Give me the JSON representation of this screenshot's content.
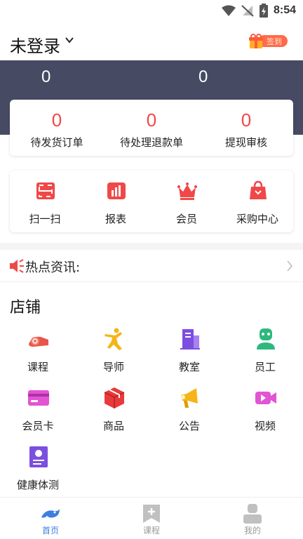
{
  "status_bar": {
    "time": "8:54"
  },
  "header": {
    "title": "未登录",
    "signin_label": "签到"
  },
  "stats": {
    "left_value": "0",
    "right_value": "0"
  },
  "orders": [
    {
      "value": "0",
      "label": "待发货订单"
    },
    {
      "value": "0",
      "label": "待处理退款单"
    },
    {
      "value": "0",
      "label": "提现审核"
    }
  ],
  "tools": [
    {
      "label": "扫一扫",
      "icon": "scan-icon"
    },
    {
      "label": "报表",
      "icon": "report-icon"
    },
    {
      "label": "会员",
      "icon": "crown-icon"
    },
    {
      "label": "采购中心",
      "icon": "shopping-bag-icon"
    }
  ],
  "news": {
    "label": "热点资讯:"
  },
  "store": {
    "title": "店铺",
    "items": [
      {
        "label": "课程",
        "icon": "course-icon"
      },
      {
        "label": "导师",
        "icon": "tutor-icon"
      },
      {
        "label": "教室",
        "icon": "classroom-icon"
      },
      {
        "label": "员工",
        "icon": "staff-icon"
      },
      {
        "label": "会员卡",
        "icon": "member-card-icon"
      },
      {
        "label": "商品",
        "icon": "product-icon"
      },
      {
        "label": "公告",
        "icon": "announcement-icon"
      },
      {
        "label": "视频",
        "icon": "video-icon"
      },
      {
        "label": "健康体测",
        "icon": "health-test-icon"
      }
    ]
  },
  "bottom_nav": {
    "active_index": 0,
    "items": [
      {
        "label": "首页",
        "icon": "home-icon"
      },
      {
        "label": "课程",
        "icon": "course-bookmark-icon"
      },
      {
        "label": "我的",
        "icon": "profile-icon"
      }
    ]
  },
  "colors": {
    "accent_red": "#f04848",
    "band_dark": "#464a63",
    "nav_active": "#3d7fe0",
    "nav_inactive": "#9a9a9a"
  }
}
